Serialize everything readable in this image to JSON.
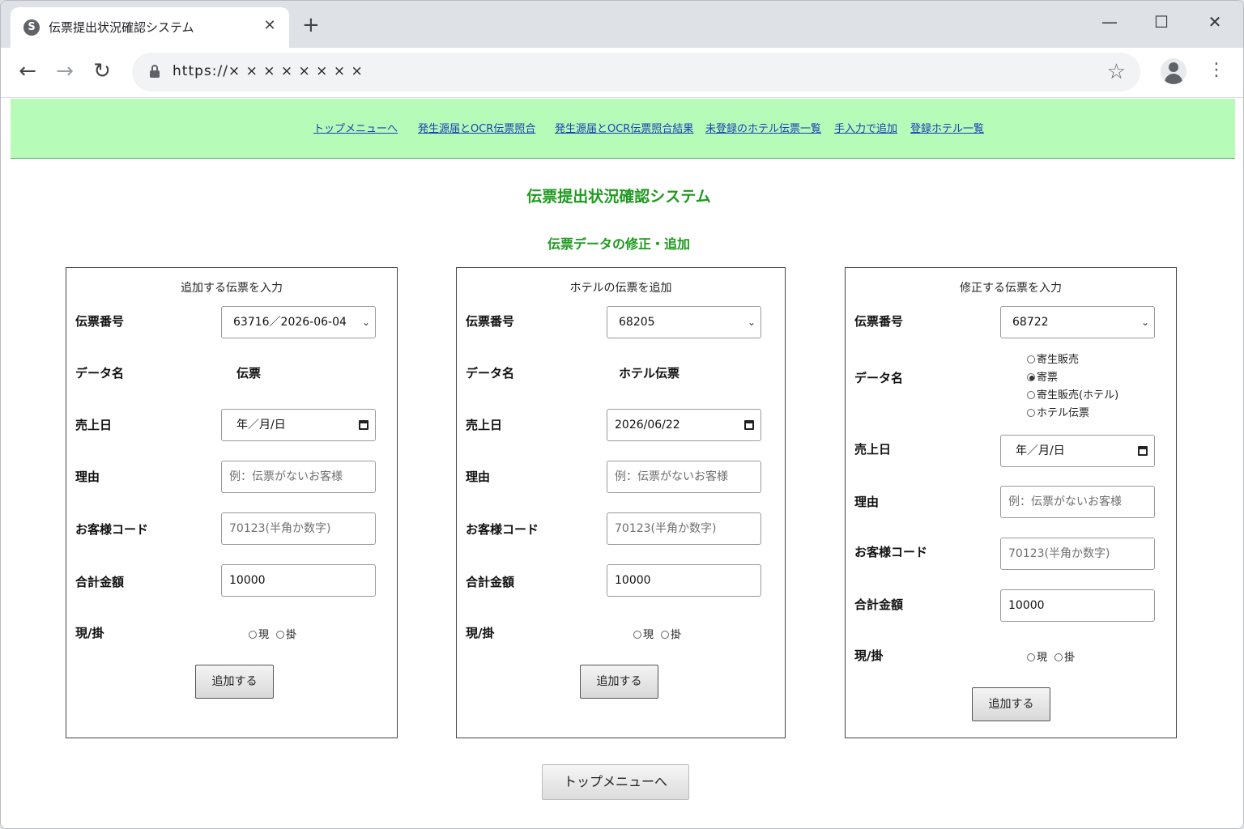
{
  "browser": {
    "tab_title": "伝票提出状況確認システム",
    "tab_close": "✕",
    "new_tab": "+",
    "url": "https://× × × × × × × ×",
    "win_min": "—",
    "win_max": "☐",
    "win_close": "✕",
    "back": "←",
    "forward": "→",
    "reload": "↻",
    "star": "☆",
    "menu": "⋮",
    "favicon": "S"
  },
  "nav": {
    "links": [
      "トップメニューへ",
      "発生源届とOCR伝票照合",
      "発生源届とOCR伝票照合結果",
      "未登録のホテル伝票一覧",
      "手入力で追加",
      "登録ホテル一覧"
    ]
  },
  "page": {
    "title": "伝票提出状況確認システム",
    "subtitle": "伝票データの修正・追加"
  },
  "labels": {
    "slip_number": "伝票番号",
    "data_name": "データ名",
    "sales_date": "売上日",
    "reason": "理由",
    "customer_code": "お客様コード",
    "total": "合計金額",
    "cash_credit": "現/掛",
    "cash": "現",
    "credit": "掛",
    "reason_placeholder": "例：伝票がないお客様",
    "customer_placeholder": "70123(半角か数字)",
    "date_placeholder": "年／月/日",
    "date_placeholder_b": "年／月/日"
  },
  "panels": [
    {
      "heading": "追加する伝票を入力",
      "slip_number": "63716／2026-06-04",
      "data_name": "伝票",
      "sales_date": "",
      "total": "10000",
      "button": "追加する"
    },
    {
      "heading": "ホテルの伝票を追加",
      "slip_number": "68205",
      "data_name": "ホテル伝票",
      "sales_date": "2026/06/22",
      "total": "10000",
      "button": "追加する"
    },
    {
      "heading": "修正する伝票を入力",
      "slip_number": "68722",
      "data_name_options": [
        "寄生販売",
        "寄票",
        "寄生販売(ホテル)",
        "ホテル伝票"
      ],
      "data_name_selected": "寄票",
      "sales_date": "",
      "total": "10000",
      "button": "追加する"
    }
  ],
  "bottom_button": "トップメニューへ"
}
